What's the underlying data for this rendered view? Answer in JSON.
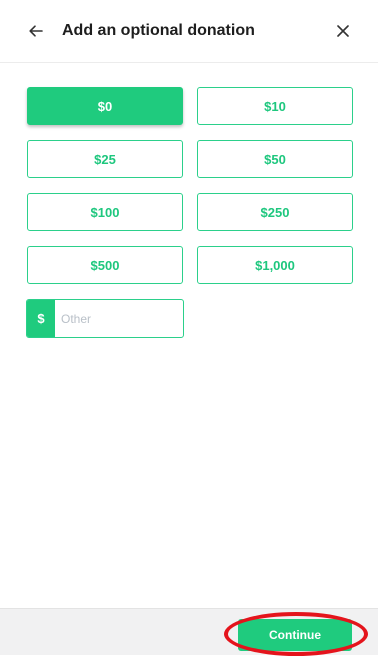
{
  "header": {
    "title": "Add an optional donation",
    "back_icon": "arrow-left-icon",
    "close_icon": "close-icon"
  },
  "donation": {
    "amounts": [
      "$0",
      "$10",
      "$25",
      "$50",
      "$100",
      "$250",
      "$500",
      "$1,000"
    ],
    "selected": "$0",
    "other": {
      "prefix": "$",
      "placeholder": "Other",
      "value": ""
    }
  },
  "footer": {
    "continue_label": "Continue"
  },
  "colors": {
    "accent": "#1fcb7e",
    "highlight": "#e4141c"
  }
}
